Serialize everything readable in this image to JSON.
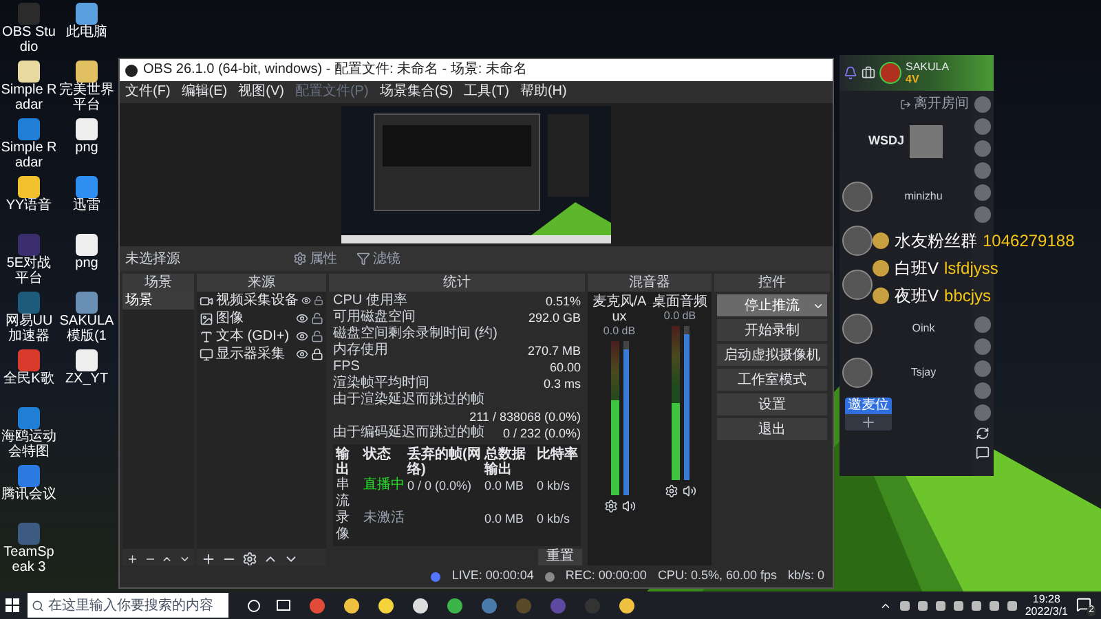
{
  "desktop": {
    "icons": [
      {
        "label": "OBS Studio"
      },
      {
        "label": "Simple Radar"
      },
      {
        "label": "Simple Radar"
      },
      {
        "label": "YY语音"
      },
      {
        "label": "5E对战平台"
      },
      {
        "label": "网易UU加速器"
      },
      {
        "label": "全民K歌"
      },
      {
        "label": "海鸥运动会特图"
      },
      {
        "label": "腾讯会议"
      },
      {
        "label": "TeamSpeak 3"
      },
      {
        "label": "此电脑"
      },
      {
        "label": "完美世界平台"
      },
      {
        "label": "png"
      },
      {
        "label": "迅雷"
      },
      {
        "label": "png"
      },
      {
        "label": "SAKULA 模版(1"
      },
      {
        "label": "ZX_YT"
      }
    ]
  },
  "obs": {
    "title": "OBS 26.1.0 (64-bit, windows) - 配置文件: 未命名 - 场景: 未命名",
    "menu": [
      {
        "label": "文件(F)",
        "disabled": false
      },
      {
        "label": "编辑(E)",
        "disabled": false
      },
      {
        "label": "视图(V)",
        "disabled": false
      },
      {
        "label": "配置文件(P)",
        "disabled": true
      },
      {
        "label": "场景集合(S)",
        "disabled": false
      },
      {
        "label": "工具(T)",
        "disabled": false
      },
      {
        "label": "帮助(H)",
        "disabled": false
      }
    ],
    "source_bar": {
      "label": "未选择源",
      "buttons": [
        {
          "label": "属性",
          "kind": "gear"
        },
        {
          "label": "滤镜",
          "kind": "filter"
        }
      ]
    },
    "scenes": {
      "title": "场景",
      "items": [
        {
          "label": "场景",
          "selected": true
        }
      ]
    },
    "sources": {
      "title": "来源",
      "items": [
        {
          "label": "视频采集设备",
          "kind": "camera",
          "visible": true,
          "locked": false
        },
        {
          "label": "图像",
          "kind": "image",
          "visible": true,
          "locked": false
        },
        {
          "label": "文本 (GDI+)",
          "kind": "text",
          "visible": true,
          "locked": false
        },
        {
          "label": "显示器采集",
          "kind": "display",
          "visible": true,
          "locked": true
        }
      ]
    },
    "stats": {
      "title": "统计",
      "rows": [
        {
          "label": "CPU 使用率",
          "value": "0.51%"
        },
        {
          "label": "可用磁盘空间",
          "value": "292.0 GB"
        },
        {
          "label": "磁盘空间剩余录制时间 (约)"
        },
        {
          "label": "内存使用",
          "value": "270.7 MB"
        },
        {
          "label": "FPS",
          "value": "60.00"
        },
        {
          "label": "渲染帧平均时间",
          "value": "0.3 ms"
        },
        {
          "label": "由于渲染延迟而跳过的帧",
          "value": "211 / 838068 (0.0%)"
        },
        {
          "label": "由于编码延迟而跳过的帧",
          "value": "0 / 232 (0.0%)"
        }
      ],
      "table": {
        "columns": [
          "输出",
          "状态",
          "丢弃的帧(网络)",
          "总数据输出",
          "比特率"
        ],
        "rows": [
          {
            "output": "串流",
            "status": "直播中",
            "active": true,
            "dropped": "0 / 0 (0.0%)",
            "total": "0.0 MB",
            "bitrate": "0 kb/s"
          },
          {
            "output": "录像",
            "status": "未激活",
            "active": false,
            "total": "0.0 MB",
            "bitrate": "0 kb/s"
          }
        ]
      },
      "reset_button": "重置"
    },
    "mixer": {
      "title": "混音器",
      "channels": [
        {
          "name": "麦克风/Aux",
          "reading": "0.0 dB",
          "muted": false,
          "meter": {
            "level": 0.62
          },
          "fader": {
            "level": 0.95
          }
        },
        {
          "name": "桌面音频",
          "reading": "0.0 dB",
          "muted": false,
          "meter": {
            "level": 0.5
          },
          "fader": {
            "level": 0.95
          }
        }
      ]
    },
    "controls": {
      "title": "控件",
      "buttons": [
        {
          "label": "停止推流",
          "kind": "dropdown",
          "selected": true
        },
        {
          "label": "开始录制",
          "kind": "plain",
          "selected": false
        },
        {
          "label": "启动虚拟摄像机",
          "kind": "plain",
          "selected": false
        },
        {
          "label": "工作室模式",
          "kind": "plain",
          "selected": false
        },
        {
          "label": "设置",
          "kind": "plain",
          "selected": false
        },
        {
          "label": "退出",
          "kind": "plain",
          "selected": false
        }
      ]
    },
    "status_bar": {
      "live": "LIVE: 00:00:04",
      "rec": "REC: 00:00:00",
      "cpu": "CPU: 0.5%, 60.00 fps",
      "bitrate": "kb/s: 0"
    }
  },
  "chat_app": {
    "user": {
      "name": "SAKULA",
      "level": "4V"
    },
    "leave": "离开房间",
    "host": "WSDJ",
    "members": [
      {
        "kind": "named",
        "name": "minizhu"
      },
      {
        "kind": "avatar"
      },
      {
        "kind": "avatar"
      },
      {
        "kind": "named",
        "name": "Oink"
      },
      {
        "kind": "named",
        "name": "Tsjay"
      }
    ],
    "mic_slot": "邀麦位"
  },
  "overlay": [
    {
      "label": "水友粉丝群",
      "value": "1046279188"
    },
    {
      "label": "白班V",
      "value": "lsfdjyss"
    },
    {
      "label": "夜班V",
      "value": "bbcjys"
    }
  ],
  "taskbar": {
    "search": {
      "placeholder": "在这里输入你要搜索的内容"
    },
    "time": "19:28",
    "date": "2022/3/1",
    "notifications": "2"
  }
}
